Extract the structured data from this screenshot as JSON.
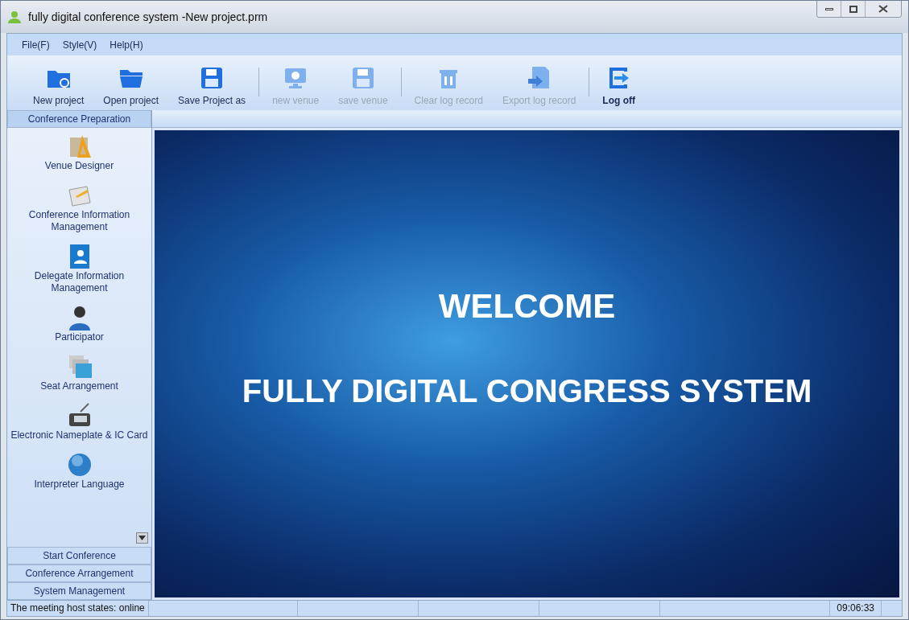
{
  "window": {
    "title": "fully digital conference system -New project.prm"
  },
  "menu": [
    "File(F)",
    "Style(V)",
    "Help(H)"
  ],
  "toolbar_groups": [
    {
      "buttons": [
        {
          "label": "New project",
          "kind": "newfolder",
          "disabled": false
        },
        {
          "label": "Open  project",
          "kind": "folder",
          "disabled": false
        },
        {
          "label": "Save Project as",
          "kind": "save",
          "disabled": false
        }
      ]
    },
    {
      "buttons": [
        {
          "label": "new venue",
          "kind": "monitor",
          "disabled": true
        },
        {
          "label": "save venue",
          "kind": "save",
          "disabled": true
        }
      ]
    },
    {
      "buttons": [
        {
          "label": "Clear log record",
          "kind": "trash",
          "disabled": true
        },
        {
          "label": "Export log record",
          "kind": "export",
          "disabled": true
        }
      ]
    },
    {
      "buttons": [
        {
          "label": "Log off",
          "kind": "logoff",
          "disabled": false
        }
      ]
    }
  ],
  "sidebar": {
    "groups": [
      {
        "label": "Conference Preparation",
        "expanded": true,
        "items": [
          {
            "label": "Venue Designer",
            "kind": "ruler"
          },
          {
            "label": "Conference Information Management",
            "kind": "pin"
          },
          {
            "label": "Delegate Information Management",
            "kind": "book"
          },
          {
            "label": "Participator",
            "kind": "person"
          },
          {
            "label": "Seat Arrangement",
            "kind": "photos"
          },
          {
            "label": "Electronic Nameplate & IC Card",
            "kind": "device"
          },
          {
            "label": "Interpreter Language",
            "kind": "globe"
          }
        ]
      },
      {
        "label": "Start Conference",
        "expanded": false
      },
      {
        "label": "Conference Arrangement",
        "expanded": false
      },
      {
        "label": "System Management",
        "expanded": false
      }
    ]
  },
  "banner": {
    "heading": "WELCOME",
    "subheading": "FULLY DIGITAL CONGRESS SYSTEM"
  },
  "status_bar": {
    "left": "The meeting host states: online",
    "time": "09:06:33"
  }
}
